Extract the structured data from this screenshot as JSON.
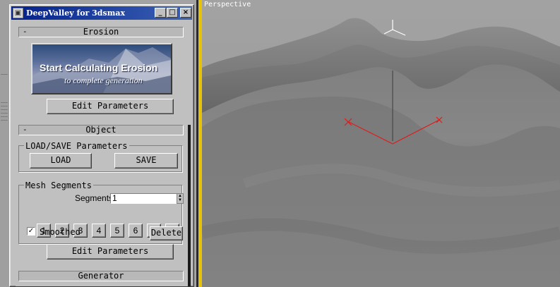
{
  "window": {
    "title": "DeepValley for 3dsmax",
    "icon": "app-icon",
    "controls": [
      "minimize-icon",
      "maximize-icon",
      "close-icon"
    ]
  },
  "erosion": {
    "header_sign": "-",
    "header": "Erosion",
    "banner_title": "Start Calculating Erosion",
    "banner_subtitle": "to complete generation",
    "edit_params": "Edit Parameters"
  },
  "object": {
    "header_sign": "-",
    "header": "Object",
    "loadsave": {
      "label": "LOAD/SAVE Parameters",
      "load": "LOAD",
      "save": "SAVE"
    },
    "mesh": {
      "label": "Mesh Segments",
      "segments_label": "Segments",
      "segments_value": "1",
      "buttons": [
        "1",
        "2",
        "3",
        "4",
        "5",
        "6",
        "7",
        "8"
      ]
    },
    "smoothed": {
      "label": "Smoothed",
      "checked": true
    },
    "delete": "Delete",
    "edit_params": "Edit Parameters"
  },
  "generator": {
    "header": "Generator"
  },
  "viewport": {
    "label": "Perspective"
  },
  "colors": {
    "titlebar": "#0a246a",
    "viewport_divider": "#e6c10a",
    "gizmo": "#e01a1a"
  }
}
